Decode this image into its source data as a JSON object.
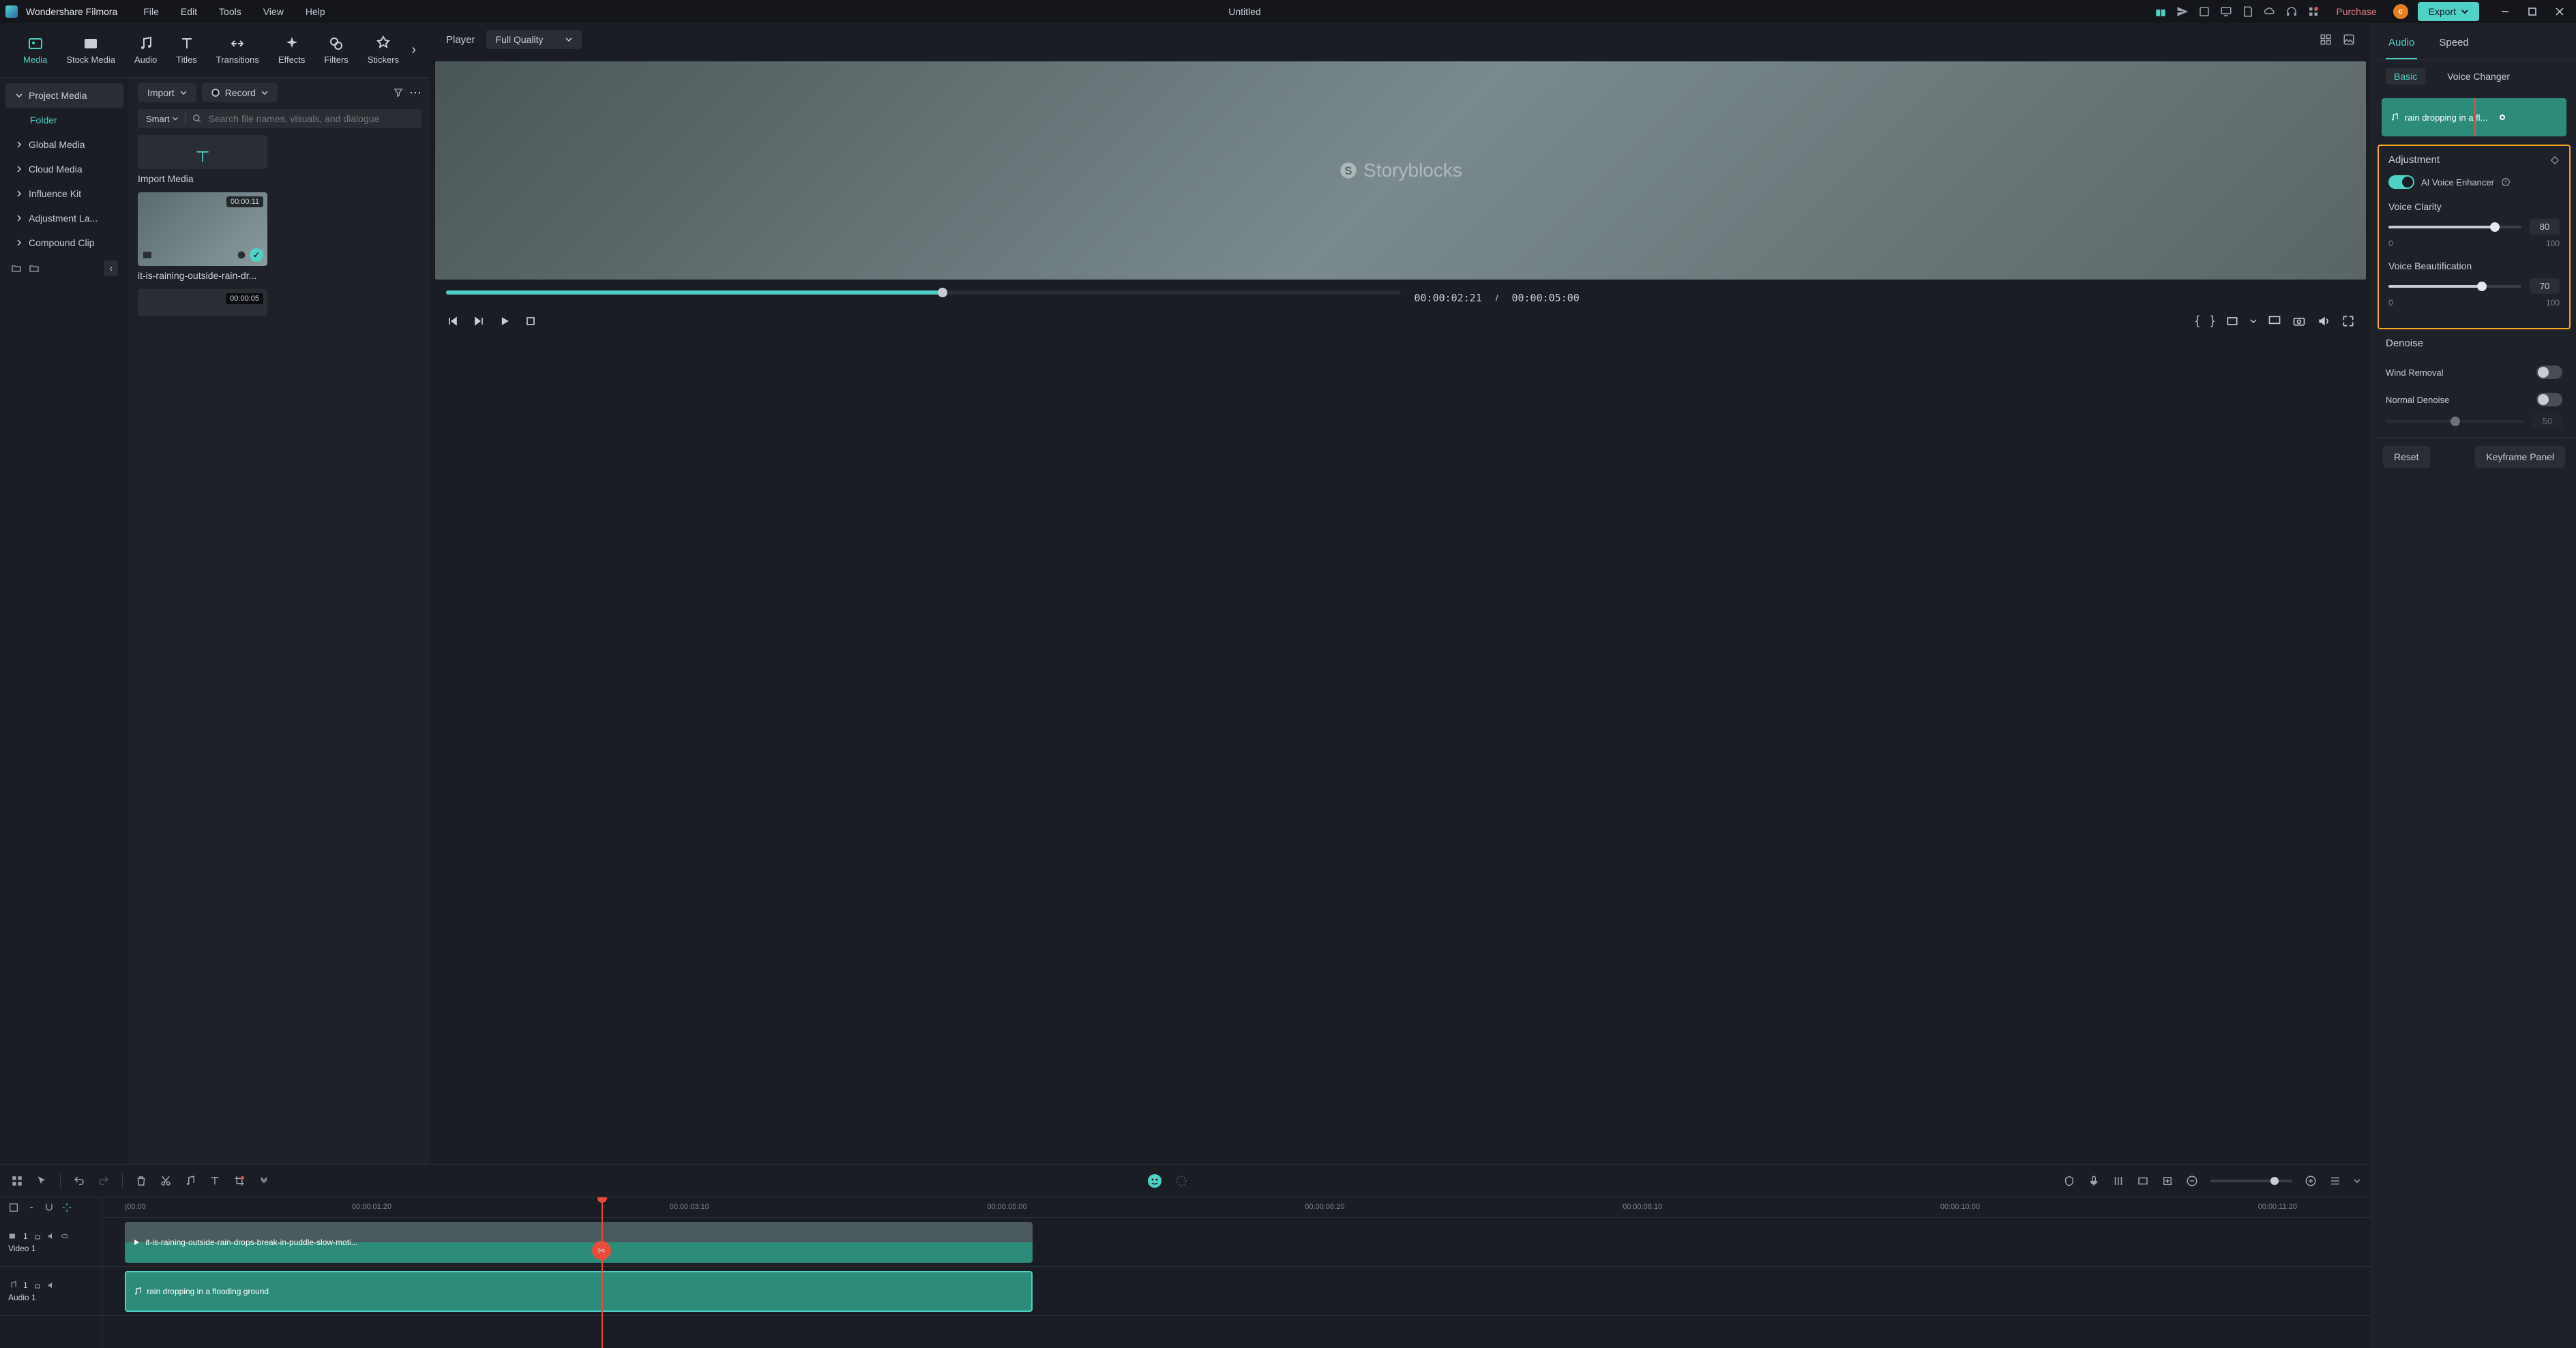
{
  "app": {
    "name": "Wondershare Filmora",
    "title": "Untitled"
  },
  "menu": [
    "File",
    "Edit",
    "Tools",
    "View",
    "Help"
  ],
  "titlebar": {
    "purchase": "Purchase",
    "export": "Export",
    "user_initial": "c"
  },
  "toolTabs": [
    {
      "label": "Media",
      "active": true
    },
    {
      "label": "Stock Media"
    },
    {
      "label": "Audio"
    },
    {
      "label": "Titles"
    },
    {
      "label": "Transitions"
    },
    {
      "label": "Effects"
    },
    {
      "label": "Filters"
    },
    {
      "label": "Stickers"
    }
  ],
  "sidebar": {
    "items": [
      {
        "label": "Project Media",
        "expanded": true
      },
      {
        "label": "Folder",
        "folder": true
      },
      {
        "label": "Global Media"
      },
      {
        "label": "Cloud Media"
      },
      {
        "label": "Influence Kit"
      },
      {
        "label": "Adjustment La..."
      },
      {
        "label": "Compound Clip"
      }
    ]
  },
  "mediaContent": {
    "import": "Import",
    "record": "Record",
    "smart": "Smart",
    "search_placeholder": "Search file names, visuals, and dialogue",
    "import_media_label": "Import Media",
    "clips": [
      {
        "duration": "00:00:11",
        "name": "it-is-raining-outside-rain-dr..."
      },
      {
        "duration": "00:00:05"
      }
    ]
  },
  "player": {
    "label": "Player",
    "quality": "Full Quality",
    "watermark": "Storyblocks",
    "current": "00:00:02:21",
    "total": "00:00:05:00"
  },
  "rightPanel": {
    "tabs": [
      "Audio",
      "Speed"
    ],
    "subTabs": [
      "Basic",
      "Voice Changer"
    ],
    "clip_name": "rain dropping in a fl...",
    "adjustment": "Adjustment",
    "ai_enhance": "AI Voice Enhancer",
    "clarity": {
      "label": "Voice Clarity",
      "value": "80",
      "min": "0",
      "max": "100",
      "pct": 80
    },
    "beauty": {
      "label": "Voice Beautification",
      "value": "70",
      "min": "0",
      "max": "100",
      "pct": 70
    },
    "denoise": "Denoise",
    "wind": "Wind Removal",
    "normal": "Normal Denoise",
    "normal_val": "50",
    "reset": "Reset",
    "keyframe": "Keyframe Panel"
  },
  "timeline": {
    "marks": [
      "|00:00",
      "00:00:01:20",
      "00:00:03:10",
      "00:00:05:00",
      "00:00:06:20",
      "00:00:08:10",
      "00:00:10:00",
      "00:00:11:20"
    ],
    "tracks": [
      {
        "name": "Video 1"
      },
      {
        "name": "Audio 1"
      }
    ],
    "clip_video": "it-is-raining-outside-rain-drops-break-in-puddle-slow-moti...",
    "clip_audio": "rain dropping in a flooding ground",
    "playhead_pct": 22
  }
}
